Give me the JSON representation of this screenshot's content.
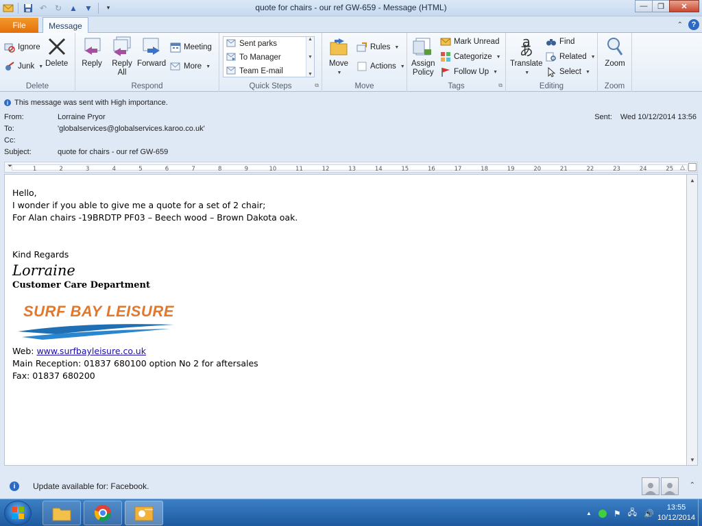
{
  "window": {
    "title": "quote for chairs  - our ref GW-659  -  Message (HTML)",
    "minimize_icon": "minimize-icon",
    "restore_icon": "restore-icon",
    "close_icon": "close-icon"
  },
  "tabs": {
    "file": "File",
    "message": "Message"
  },
  "ribbon": {
    "delete_group": {
      "label": "Delete",
      "ignore": "Ignore",
      "junk": "Junk",
      "delete": "Delete"
    },
    "respond_group": {
      "label": "Respond",
      "reply": "Reply",
      "reply_all_1": "Reply",
      "reply_all_2": "All",
      "forward": "Forward",
      "meeting": "Meeting",
      "more": "More"
    },
    "quick_steps_group": {
      "label": "Quick Steps",
      "items": [
        "Sent parks",
        "To Manager",
        "Team E-mail"
      ]
    },
    "move_group": {
      "label": "Move",
      "move": "Move",
      "rules": "Rules",
      "actions": "Actions"
    },
    "tags_group": {
      "label": "Tags",
      "assign_policy_1": "Assign",
      "assign_policy_2": "Policy",
      "mark_unread": "Mark Unread",
      "categorize": "Categorize",
      "follow_up": "Follow Up"
    },
    "editing_group": {
      "label": "Editing",
      "translate": "Translate",
      "find": "Find",
      "related": "Related",
      "select": "Select"
    },
    "zoom_group": {
      "label": "Zoom",
      "zoom": "Zoom"
    }
  },
  "header": {
    "importance": "This message was sent with High importance.",
    "from_label": "From:",
    "from_value": "Lorraine Pryor",
    "to_label": "To:",
    "to_value": "'globalservices@globalservices.karoo.co.uk'",
    "cc_label": "Cc:",
    "cc_value": "",
    "subject_label": "Subject:",
    "subject_value": "quote for chairs  - our ref GW-659",
    "sent_label": "Sent:",
    "sent_value": "Wed 10/12/2014 13:56"
  },
  "ruler": {
    "ticks": [
      "1",
      "2",
      "3",
      "4",
      "5",
      "6",
      "7",
      "8",
      "9",
      "10",
      "11",
      "12",
      "13",
      "14",
      "15",
      "16",
      "17",
      "18",
      "19",
      "20",
      "21",
      "22",
      "23",
      "24",
      "25"
    ]
  },
  "body": {
    "greeting": "Hello,",
    "line1": "I wonder if you able to give me a quote for a set of 2 chair;",
    "line2": "For Alan chairs -19BRDTP PF03 – Beech wood – Brown Dakota oak.",
    "regards": "Kind Regards",
    "signature_name": "Lorraine",
    "department": "Customer Care Department",
    "logo_text": "SURF BAY LEISURE",
    "web_label": "Web: ",
    "web_link": "www.surfbayleisure.co.uk",
    "reception": "Main Reception:  01837 680100 option No 2 for aftersales",
    "fax": "Fax:  01837 680200"
  },
  "notification": {
    "text": "Update available for: Facebook."
  },
  "taskbar": {
    "time": "13:55",
    "date": "10/12/2014"
  },
  "colors": {
    "accent_file_tab": "#e46f0a",
    "link": "#1a0dab",
    "logo_orange": "#e3772b",
    "logo_blue": "#1f6fb5"
  }
}
